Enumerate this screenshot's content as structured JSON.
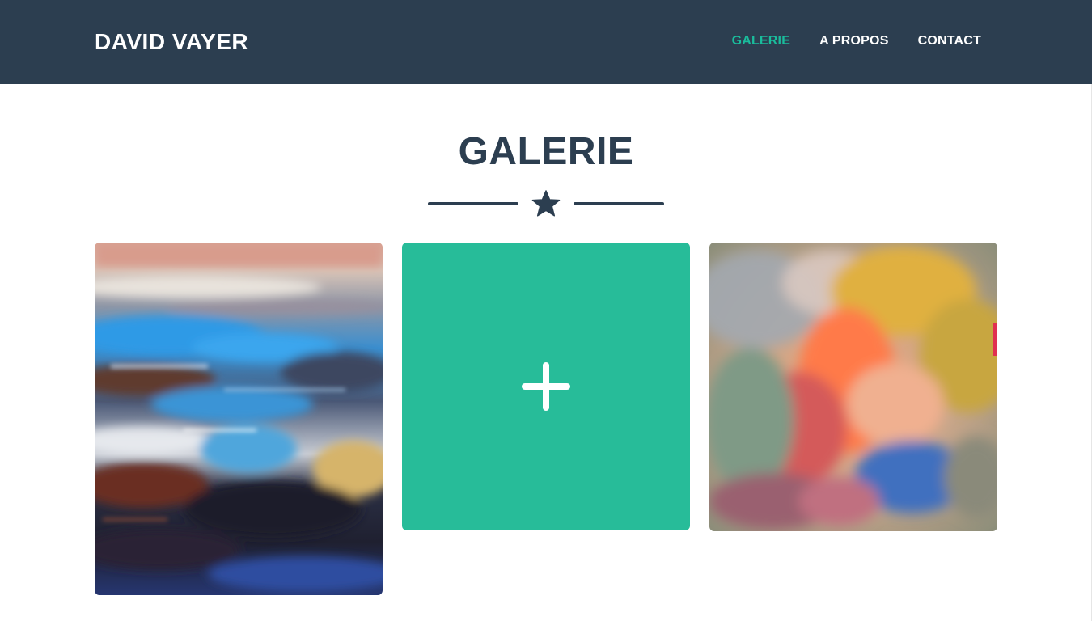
{
  "navbar": {
    "brand": "DAVID VAYER",
    "links": [
      {
        "label": "GALERIE",
        "active": true
      },
      {
        "label": "A PROPOS",
        "active": false
      },
      {
        "label": "CONTACT",
        "active": false
      }
    ]
  },
  "gallery": {
    "title": "GALERIE",
    "divider_icon": "star-icon",
    "items": [
      {
        "type": "painting",
        "description_icon": "abstract-painting-blue"
      },
      {
        "type": "hover-overlay",
        "icon": "plus-icon"
      },
      {
        "type": "painting",
        "description_icon": "abstract-painting-orange"
      }
    ]
  },
  "colors": {
    "navbar_bg": "#2c3e50",
    "accent": "#1abc9c",
    "overlay": "#27bc99",
    "text_dark": "#2c3e50"
  }
}
